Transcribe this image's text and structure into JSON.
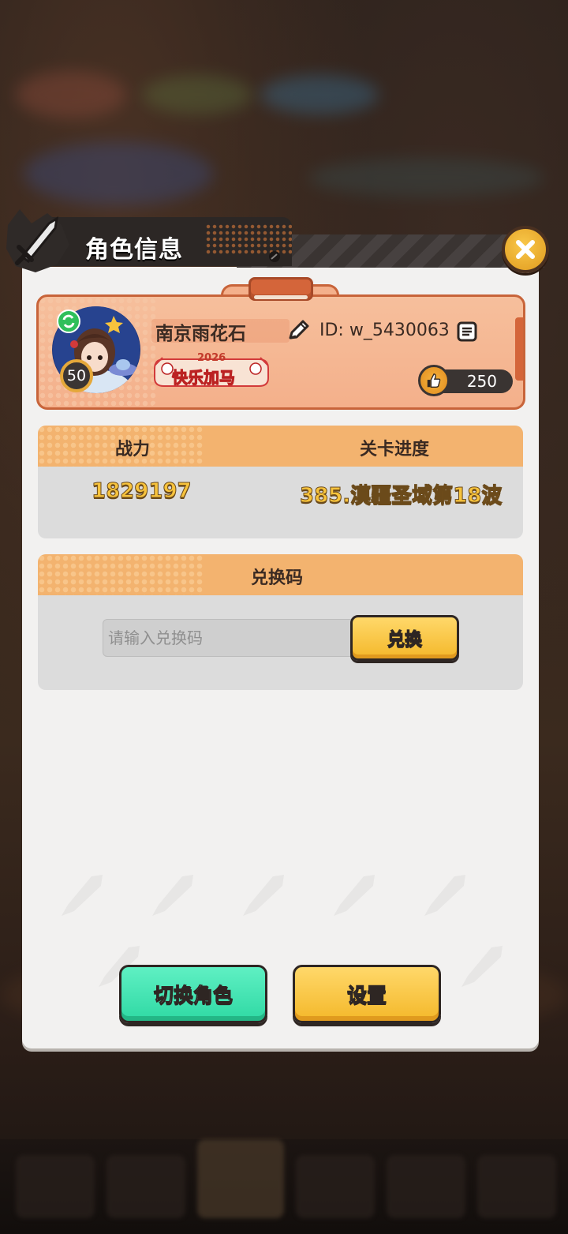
{
  "header": {
    "title": "角色信息"
  },
  "profile": {
    "name": "南京雨花石",
    "id_text": "ID: w_5430063",
    "level": "50",
    "title_badge_text": "快乐加马",
    "title_badge_year": "2026",
    "likes": "250"
  },
  "stats": {
    "power_label": "战力",
    "power_value": "1829197",
    "progress_label": "关卡进度",
    "progress_value": "385.漠疆圣域第18波"
  },
  "redeem": {
    "section_title": "兑换码",
    "placeholder": "请输入兑换码",
    "button_label": "兑换"
  },
  "actions": {
    "switch_role_label": "切换角色",
    "settings_label": "设置"
  },
  "colors": {
    "accent_orange": "#f3b36f",
    "card_salmon": "#f4b08b",
    "button_green": "#2fd9a4",
    "button_yellow": "#f4b82a",
    "value_gold": "#f7c33c"
  }
}
